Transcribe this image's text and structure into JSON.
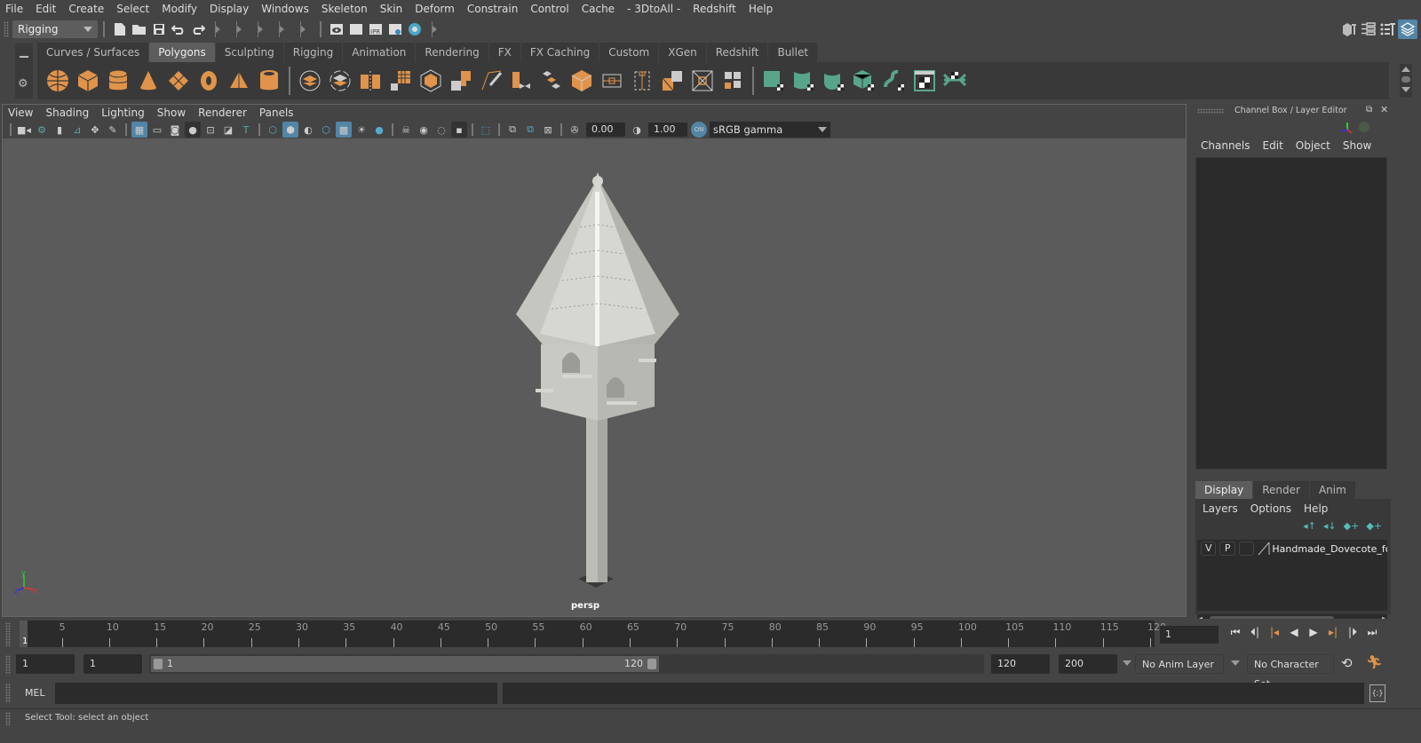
{
  "menubar": {
    "items": [
      "File",
      "Edit",
      "Create",
      "Select",
      "Modify",
      "Display",
      "Windows",
      "Skeleton",
      "Skin",
      "Deform",
      "Constrain",
      "Control",
      "Cache",
      "- 3DtoAll -",
      "Redshift",
      "Help"
    ]
  },
  "statusline": {
    "mode_selector": "Rigging",
    "icons": [
      "new-scene-icon",
      "open-scene-icon",
      "save-scene-icon",
      "undo-icon",
      "redo-icon"
    ],
    "render_icons": [
      "render-view-icon",
      "render-frame-icon",
      "ipr-render-icon",
      "render-settings-icon",
      "hypershade-icon"
    ],
    "right_icons": [
      "modeling-toolkit-icon",
      "attribute-editor-icon",
      "tool-settings-icon",
      "channel-box-layer-editor-icon"
    ]
  },
  "shelf": {
    "tabs": [
      "Curves / Surfaces",
      "Polygons",
      "Sculpting",
      "Rigging",
      "Animation",
      "Rendering",
      "FX",
      "FX Caching",
      "Custom",
      "XGen",
      "Redshift",
      "Bullet"
    ],
    "active_tab": "Polygons",
    "primitive_icons": [
      "poly-sphere-icon",
      "poly-cube-icon",
      "poly-cylinder-icon",
      "poly-cone-icon",
      "poly-plane-icon",
      "poly-torus-icon",
      "poly-pyramid-icon",
      "poly-pipe-icon"
    ],
    "tool_icons": [
      "combine-icon",
      "separate-icon",
      "mirror-icon",
      "smooth-icon",
      "bevel-icon",
      "extrude-icon",
      "multi-cut-icon",
      "target-weld-icon",
      "bridge-icon",
      "extrude-face-icon",
      "edge-loop-icon",
      "insert-loop-icon",
      "append-polygon-icon",
      "fill-hole-icon",
      "reduce-icon"
    ],
    "uv_icons": [
      "planar-uv-icon",
      "cylindrical-uv-icon",
      "spherical-uv-icon",
      "automatic-uv-icon",
      "unfold-uv-icon",
      "uv-editor-icon",
      "layout-uv-icon"
    ],
    "accent_orange": "#e0934a",
    "accent_green": "#58a58a"
  },
  "viewport": {
    "menu": [
      "View",
      "Shading",
      "Lighting",
      "Show",
      "Renderer",
      "Panels"
    ],
    "exposure": "0.00",
    "gamma": "1.00",
    "color_mgmt": "ON",
    "color_space": "sRGB gamma",
    "camera_label": "persp",
    "axis_labels": {
      "x": "x",
      "y": "y",
      "z": "z"
    },
    "model_name": "Handmade Dovecote"
  },
  "channel_box": {
    "title": "Channel Box / Layer Editor",
    "menu": [
      "Channels",
      "Edit",
      "Object",
      "Show"
    ]
  },
  "layer_editor": {
    "tabs": [
      "Display",
      "Render",
      "Anim"
    ],
    "active_tab": "Display",
    "menu": [
      "Layers",
      "Options",
      "Help"
    ],
    "layers": [
      {
        "v": "V",
        "p": "P",
        "name": "Handmade_Dovecote_fo"
      }
    ]
  },
  "timeline": {
    "ticks": [
      5,
      10,
      15,
      20,
      25,
      30,
      35,
      40,
      45,
      50,
      55,
      60,
      65,
      70,
      75,
      80,
      85,
      90,
      95,
      100,
      105,
      110,
      115,
      120
    ],
    "start": 1,
    "end": 120,
    "current_frame_marker": "1",
    "current_frame": "1"
  },
  "range": {
    "start_anim": "1",
    "start_playback": "1",
    "slider_start": "1",
    "slider_end": "120",
    "end_playback": "120",
    "end_anim": "200",
    "anim_layer": "No Anim Layer",
    "character_set": "No Character Set"
  },
  "command_line": {
    "label": "MEL",
    "value": ""
  },
  "help_line": {
    "text": "Select Tool: select an object"
  }
}
